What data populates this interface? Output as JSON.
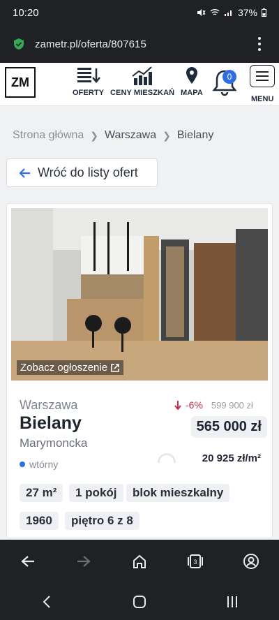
{
  "status_bar": {
    "time": "10:20",
    "battery": "37%"
  },
  "browser": {
    "url": "zametr.pl/oferta/807615"
  },
  "header": {
    "logo": "ZM",
    "nav": [
      {
        "label": "OFERTY",
        "icon": "list-sort-icon"
      },
      {
        "label": "CENY MIESZKAŃ",
        "icon": "bar-chart-icon"
      },
      {
        "label": "MAPA",
        "icon": "map-pin-icon"
      }
    ],
    "notifications_count": "0",
    "menu_label": "MENU"
  },
  "breadcrumb": [
    "Strona główna",
    "Warszawa",
    "Bielany"
  ],
  "back_button": "Wróć do listy ofert",
  "listing": {
    "photo_link": "Zobacz ogłoszenie",
    "city": "Warszawa",
    "district": "Bielany",
    "street": "Marymoncka",
    "market": "wtórny",
    "price_change": "-6%",
    "old_price": "599 900 zł",
    "price": "565 000 zł",
    "price_per_m2": "20 925 zł/m²",
    "tags": [
      "27 m²",
      "1 pokój",
      "blok mieszkalny",
      "1960",
      "piętro 6 z 8"
    ]
  },
  "colors": {
    "accent": "#2f6ee0",
    "price_drop": "#c0304f",
    "dark_bar": "#1f2125"
  }
}
